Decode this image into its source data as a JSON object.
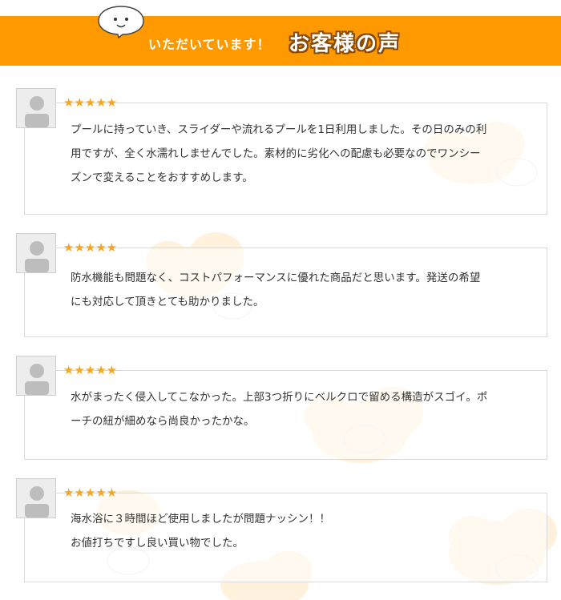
{
  "header": {
    "subtitle": "いただいています！",
    "title": "お客様の声",
    "accent_color": "#ff9900",
    "mascot_icon": "speech-bubble-face-icon"
  },
  "rating_symbol": "★★★★★",
  "reviews": [
    {
      "stars": 5,
      "lines": [
        "プールに持っていき、スライダーや流れるプールを1日利用しました。その日のみの利",
        "用ですが、全く水濡れしませんでした。素材的に劣化への配慮も必要なのでワンシー",
        "ズンで変えることをおすすめします。"
      ]
    },
    {
      "stars": 5,
      "lines": [
        "防水機能も問題なく、コストパフォーマンスに優れた商品だと思います。発送の希望",
        "にも対応して頂きとても助かりました。"
      ]
    },
    {
      "stars": 5,
      "lines": [
        "水がまったく侵入してこなかった。上部3つ折りにベルクロで留める構造がスゴイ。ポ",
        "ーチの紐が細めなら尚良かったかな。"
      ]
    },
    {
      "stars": 5,
      "lines": [
        "海水浴に３時間ほど使用しましたが問題ナッシン！！",
        "お値打ちですし良い買い物でした。"
      ]
    }
  ]
}
